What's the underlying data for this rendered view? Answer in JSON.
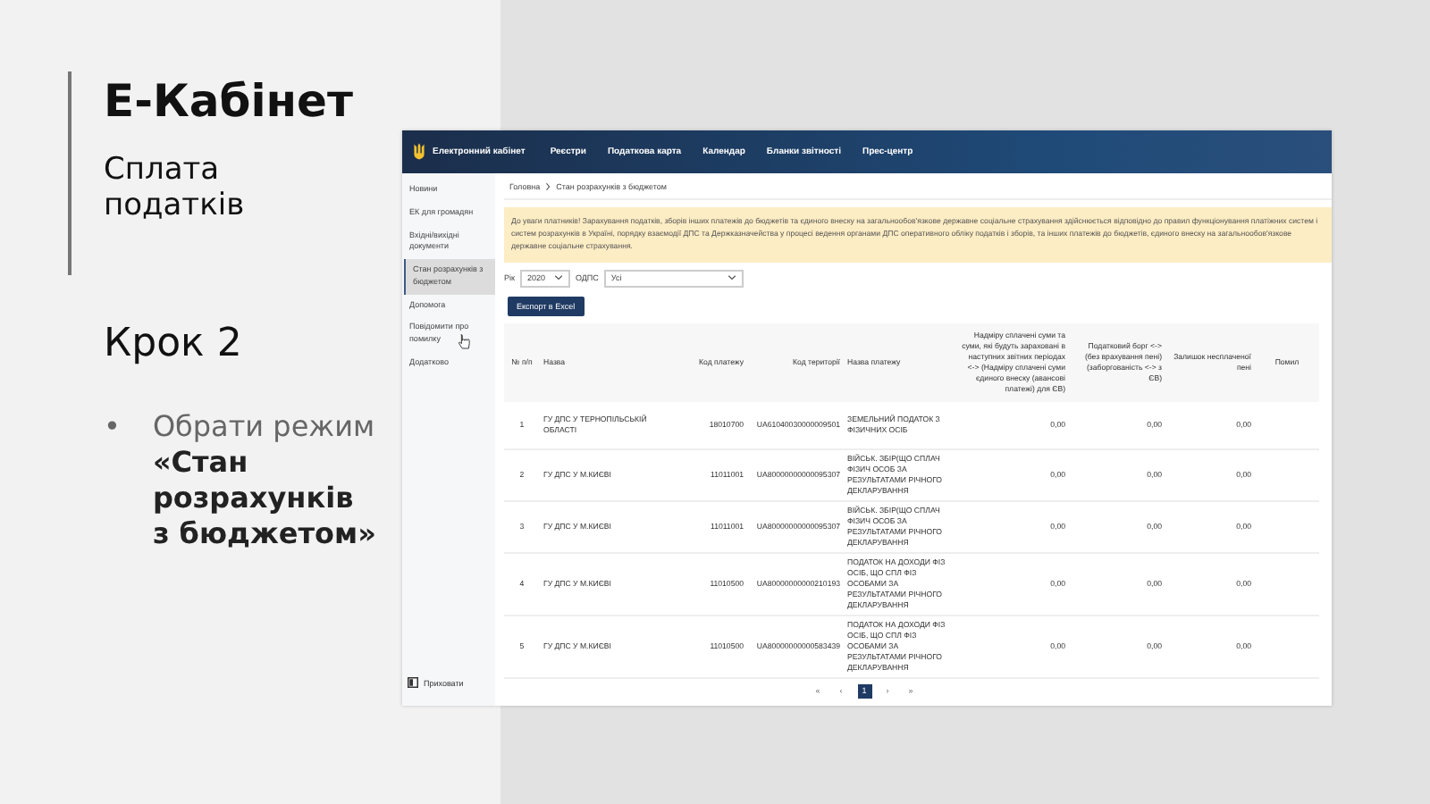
{
  "slide": {
    "title": "Е-Кабінет",
    "subtitle": "Сплата податків",
    "step": "Крок 2",
    "bullets": [
      {
        "marker": "•",
        "text": "Обрати режим **«Стан розрахунків з бюджетом»**"
      }
    ]
  },
  "app": {
    "brand": "Електронний кабінет",
    "nav": [
      "Реєстри",
      "Податкова карта",
      "Календар",
      "Бланки звітності",
      "Прес-центр"
    ],
    "sidebar": {
      "items": [
        {
          "label": "Новини",
          "selected": false
        },
        {
          "label": "ЕК для громадян",
          "selected": false
        },
        {
          "label": "Вхідні/вихідні документи",
          "selected": false
        },
        {
          "label": "Стан розрахунків з бюджетом",
          "selected": true
        },
        {
          "label": "Допомога",
          "selected": false
        },
        {
          "label": "Повідомити про помилку",
          "selected": false
        },
        {
          "label": "Додатково",
          "selected": false
        }
      ],
      "hide": "Приховати"
    },
    "breadcrumb": [
      "Головна",
      "Стан розрахунків з бюджетом"
    ],
    "notice": "До уваги платників! Зарахування податків, зборів інших платежів до бюджетів та єдиного внеску на загальнообов'язкове державне соціальне страхування здійснюється відповідно до правил функціонування платіжних систем і систем розрахунків в Україні, порядку взаємодії ДПС та Держказначейства у процесі ведення органами ДПС оперативного обліку податків і зборів, та інших платежів до бюджетів, єдиного внеску на загальнообов'язкове державне соціальне страхування.",
    "filters": [
      {
        "label": "Рік",
        "value": "2020"
      },
      {
        "label": "ОДПС",
        "value": "Усі"
      }
    ],
    "export_button": "Експорт в Excel",
    "table": {
      "columns": [
        "№ п/п",
        "Назва",
        "Код платежу",
        "Код території",
        "Назва платежу",
        "Надміру сплачені суми та суми, які будуть зараховані в наступних звітних періодах <-> (Надміру сплачені суми єдиного внеску (авансові платежі) для ЄВ)",
        "Податковий борг <-> (без врахування пені) (заборгованість <-> з ЄВ)",
        "Залишок несплаченої пені",
        "Помил"
      ],
      "rows": [
        [
          "1",
          "ГУ ДПС У ТЕРНОПІЛЬСЬКІЙ ОБЛАСТІ",
          "18010700",
          "UA61040030000009501",
          "ЗЕМЕЛЬНИЙ ПОДАТОК З ФІЗИЧНИХ ОСІБ",
          "0,00",
          "0,00",
          "0,00"
        ],
        [
          "2",
          "ГУ ДПС У М.КИЄВІ",
          "11011001",
          "UA80000000000095307",
          "ВІЙСЬК. ЗБІР(ЩО СПЛАЧ ФІЗИЧ ОСОБ ЗА РЕЗУЛЬТАТАМИ РІЧНОГО ДЕКЛАРУВАННЯ",
          "0,00",
          "0,00",
          "0,00"
        ],
        [
          "3",
          "ГУ ДПС У М.КИЄВІ",
          "11011001",
          "UA80000000000095307",
          "ВІЙСЬК. ЗБІР(ЩО СПЛАЧ ФІЗИЧ ОСОБ ЗА РЕЗУЛЬТАТАМИ РІЧНОГО ДЕКЛАРУВАННЯ",
          "0,00",
          "0,00",
          "0,00"
        ],
        [
          "4",
          "ГУ ДПС У М.КИЄВІ",
          "11010500",
          "UA80000000000210193",
          "ПОДАТОК НА ДОХОДИ ФІЗ ОСІБ, ЩО СПЛ ФІЗ ОСОБАМИ ЗА РЕЗУЛЬТАТАМИ РІЧНОГО ДЕКЛАРУВАННЯ",
          "0,00",
          "0,00",
          "0,00"
        ],
        [
          "5",
          "ГУ ДПС У М.КИЄВІ",
          "11010500",
          "UA80000000000583439",
          "ПОДАТОК НА ДОХОДИ ФІЗ ОСІБ, ЩО СПЛ ФІЗ ОСОБАМИ ЗА РЕЗУЛЬТАТАМИ РІЧНОГО ДЕКЛАРУВАННЯ",
          "0,00",
          "0,00",
          "0,00"
        ]
      ]
    },
    "pagination": [
      {
        "label": "«",
        "selected": false
      },
      {
        "label": "‹",
        "selected": false
      },
      {
        "label": "1",
        "selected": true
      },
      {
        "label": "›",
        "selected": false
      },
      {
        "label": "»",
        "selected": false
      }
    ]
  }
}
